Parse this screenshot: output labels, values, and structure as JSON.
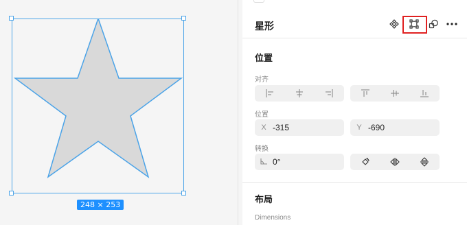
{
  "canvas": {
    "shape": "star",
    "dimensions_badge": "248 × 253",
    "fill_color": "#d9d9d9",
    "stroke_color": "#4aa3e8"
  },
  "panel": {
    "header": {
      "title": "星形",
      "icons": [
        "component-icon",
        "vector-edit-icon",
        "boolean-icon",
        "more-icon"
      ],
      "highlighted_icon": "vector-edit-icon"
    },
    "position_section": {
      "title": "位置",
      "align_label": "对齐",
      "align_icons": [
        "align-left-icon",
        "align-center-h-icon",
        "align-right-icon",
        "align-top-icon",
        "align-center-v-icon",
        "align-bottom-icon"
      ],
      "position_label": "位置",
      "x_prefix": "X",
      "x_value": "-315",
      "y_prefix": "Y",
      "y_value": "-690",
      "transform_label": "转换",
      "rotation_value": "0°",
      "transform_icons": [
        "rotate-icon",
        "flip-horizontal-icon",
        "flip-vertical-icon"
      ]
    },
    "layout_section": {
      "title": "布局",
      "dimensions_label": "Dimensions"
    }
  }
}
